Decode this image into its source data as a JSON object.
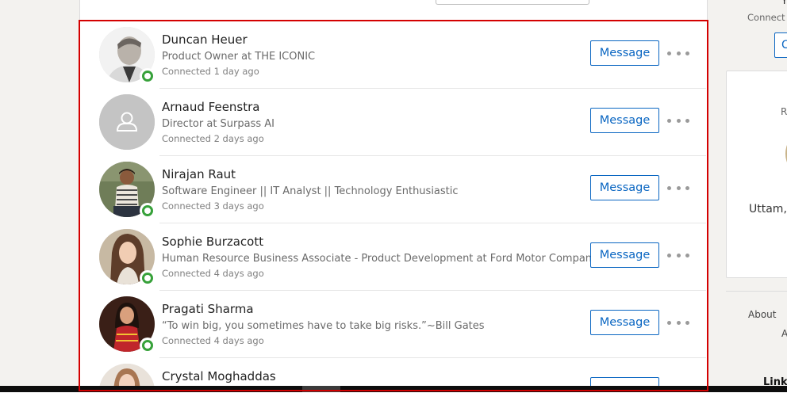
{
  "connections": [
    {
      "name": "Duncan Heuer",
      "headline": "Product Owner at THE ICONIC",
      "connected": "Connected 1 day ago",
      "online": true,
      "avatar": "photo-man-gray-hair",
      "message_label": "Message"
    },
    {
      "name": "Arnaud Feenstra",
      "headline": "Director at Surpass AI",
      "connected": "Connected 2 days ago",
      "online": false,
      "avatar": "default-person-icon",
      "message_label": "Message"
    },
    {
      "name": "Nirajan Raut",
      "headline": "Software Engineer || IT Analyst || Technology Enthusiastic",
      "connected": "Connected 3 days ago",
      "online": true,
      "avatar": "photo-man-striped-shirt",
      "message_label": "Message"
    },
    {
      "name": "Sophie Burzacott",
      "headline": "Human Resource Business Associate - Product Development at Ford Motor Company",
      "connected": "Connected 4 days ago",
      "online": true,
      "avatar": "photo-woman-long-hair",
      "message_label": "Message"
    },
    {
      "name": "Pragati Sharma",
      "headline": "“To win big, you sometimes have to take big risks.”~Bill Gates",
      "connected": "Connected 4 days ago",
      "online": true,
      "avatar": "photo-woman-red-dress",
      "message_label": "Message"
    },
    {
      "name": "Crystal Moghaddas",
      "headline": "",
      "connected": "",
      "online": false,
      "avatar": "photo-woman-brown-hair",
      "message_label": ""
    }
  ],
  "right_rail": {
    "top_fragment": "Y",
    "connect_fragment": "Connect w",
    "button_fragment": "C",
    "card_label_fragment": "R",
    "card_text_fragment": "Uttam, ",
    "about_link": "About",
    "second_link_fragment": "A",
    "footer_brand_fragment": "Linke"
  },
  "colors": {
    "accent": "#0a66c2",
    "presence": "#37a13a",
    "highlight_border": "#d40000"
  }
}
